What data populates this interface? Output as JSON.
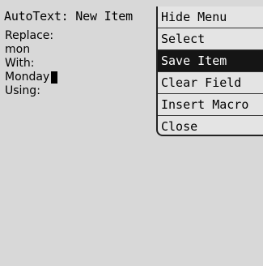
{
  "window": {
    "title": "AutoText: New Item"
  },
  "fields": {
    "replace_label": "Replace:",
    "replace_value": "mon",
    "with_label": "With:",
    "with_value": "Monday",
    "using_label": "Using:"
  },
  "menu": {
    "items": [
      {
        "label": "Hide Menu"
      },
      {
        "label": "Select"
      },
      {
        "label": "Save Item",
        "selected": true
      },
      {
        "label": "Clear Field"
      },
      {
        "label": "Insert Macro"
      },
      {
        "label": "Close"
      }
    ]
  },
  "colors": {
    "background": "#d8d8d8",
    "menu_background": "#e4e4e4",
    "selection": "#151515",
    "selection_text": "#ffffff"
  }
}
